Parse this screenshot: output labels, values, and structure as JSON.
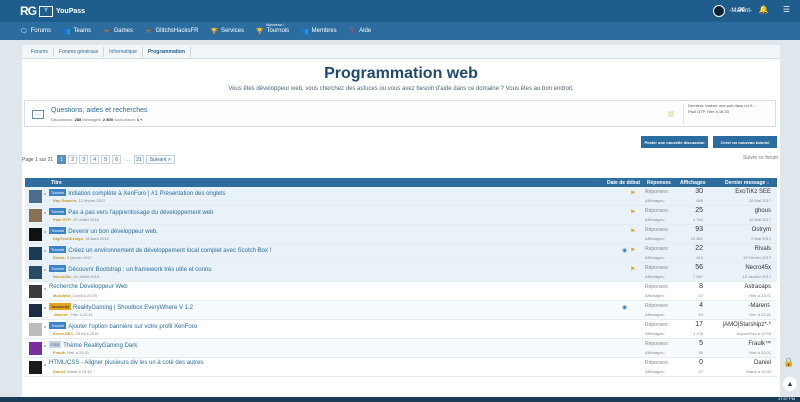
{
  "brand": {
    "logo": "RG",
    "badge": "Y",
    "name": "YouPass"
  },
  "user": {
    "name": "-Marent-"
  },
  "topicons": {
    "mail": "✉",
    "bell": "🔔",
    "menu": "☰"
  },
  "nav": [
    {
      "label": "Forums",
      "icon": "🗨"
    },
    {
      "label": "Teams",
      "icon": "👥"
    },
    {
      "label": "Games",
      "icon": "🎮"
    },
    {
      "label": "GlitchsHacksFR",
      "icon": "🎮"
    },
    {
      "label": "Services",
      "icon": "🏆"
    },
    {
      "label": "Tournois",
      "icon": "🏆",
      "sup": "Nouveau !"
    },
    {
      "label": "Membres",
      "icon": "👥"
    },
    {
      "label": "Aide",
      "icon": "❓"
    }
  ],
  "breadcrumbs": [
    "Forums",
    "Forums généraux",
    "Informatique",
    "Programmation"
  ],
  "page": {
    "title": "Programmation web",
    "description": "Vous êtes développeur web, vous cherchez des astuces ou vous avez besoin d'aide dans ce domaine ? Vous êtes au bon endroit."
  },
  "subforum": {
    "name": "Questions, aides et recherches",
    "disc_label": "Discussions:",
    "disc_value": "285",
    "msg_label": "Messages:",
    "msg_value": "2 805",
    "sub_label": "Sous-forum:",
    "sub_value": "1",
    "last_line1": "Derniers: Insérer une pub dans un X...",
    "last_line2": "Paul GTP, Hier à 18:33"
  },
  "buttons": {
    "mark_read": "Poster une nouvelle discussion",
    "new_thread": "Créer un nouveau tutoriel"
  },
  "pagination": {
    "label": "Page 1 sur 21",
    "pages": [
      "1",
      "2",
      "3",
      "4",
      "5",
      "6"
    ],
    "last": "21",
    "next": "Suivant >"
  },
  "sort_label": "Suivre ce forum",
  "table_headers": {
    "title": "Titre",
    "start_date": "Date de début",
    "replies": "Réponses",
    "views": "Affichages",
    "last_msg": "Dernier message ↓"
  },
  "labels": {
    "replies": "Réponses:",
    "views": "Affichages:"
  },
  "rows": [
    {
      "prefix": "Tutoriel",
      "ptype": "tut",
      "title": "Initiation complète à XenForo | #1 Présentation des onglets",
      "author": "Ray Gamers",
      "date": "12 février 2017",
      "replies": "30",
      "views": "685",
      "last_user": "ExoTiKz SEE",
      "last_date": "28 Mai 2017",
      "av": "#4a6d8c",
      "flag": true,
      "hl": true
    },
    {
      "prefix": "Tutoriel",
      "ptype": "tut",
      "title": "Pas à pas vers l'apprentissage du développement web",
      "author": "Paul GTP",
      "date": "20 Juillet 2016",
      "replies": "25",
      "views": "1 741",
      "last_user": "ghous",
      "last_date": "12 Mai 2017",
      "av": "#8a7055",
      "flag": true,
      "hl": true
    },
    {
      "prefix": "Tutoriel",
      "ptype": "tut",
      "title": "Devenir un bon développeur web.",
      "author": "DigiTechDesign",
      "date": "18 Août 2016",
      "replies": "93",
      "views": "10 882",
      "last_user": "Ostrym",
      "last_date": "2 Mai 2017",
      "av": "#111111",
      "flag": true,
      "hl": true
    },
    {
      "prefix": "Tutoriel",
      "ptype": "tut",
      "title": "Créez un environnement de développement local complet avec Scotch Box !",
      "author": "Rivals",
      "date": "9 janvier 2017",
      "replies": "22",
      "views": "612",
      "last_user": "Rivals",
      "last_date": "19 Février 2017",
      "av": "#1d3a55",
      "flag": true,
      "eye": true,
      "hl": true
    },
    {
      "prefix": "Tutoriel",
      "ptype": "tut",
      "title": "Découvrir Bootstrap : un framework très utile et connu",
      "author": "Necro45x",
      "date": "14 Juillet 2016",
      "replies": "56",
      "views": "7 697",
      "last_user": "Necro45x",
      "last_date": "15 Janvier 2017",
      "av": "#2a4a66",
      "flag": true,
      "hl": true
    },
    {
      "prefix": "",
      "ptype": "",
      "title": "Recherche Développeur Web",
      "author": "McAdelia",
      "date": "Lundi à 22:09",
      "replies": "8",
      "views": "47",
      "last_user": "Astracaps",
      "last_date": "Hier à 22:41",
      "av": "#3c3c3c",
      "alt": true
    },
    {
      "prefix": "Javascript",
      "ptype": "js",
      "title": "RealityGaming | Shoutbox EveryWhere V 1.2",
      "author": "-Marent-",
      "date": "Hier à 22:41",
      "replies": "4",
      "views": "54",
      "last_user": "-Marent-",
      "last_date": "Hier à 22:41",
      "av": "#1b2d45",
      "eye": true
    },
    {
      "prefix": "Tutoriel",
      "ptype": "tut",
      "title": "Ajouter l'option bannière sur votre profil XenForo",
      "author": "Kevin SEC",
      "date": "29 Avril 2015",
      "replies": "17",
      "views": "1 278",
      "last_user": "|AMO|Starshipz*-*",
      "last_date": "Aujourd'hui à 12:33",
      "av": "#bcbcbc",
      "alt": true
    },
    {
      "prefix": "CSS",
      "ptype": "css",
      "title": "Thème RealityGaming Dark",
      "author": "Fraulk",
      "date": "Hier à 20:31",
      "replies": "5",
      "views": "56",
      "last_user": "Fraulk™",
      "last_date": "Hier à 22:01",
      "av": "#7a2f9c"
    },
    {
      "prefix": "",
      "ptype": "",
      "title": "HTML/CSS - Aligner plusieurs div les un à coté des autres",
      "author": "Daniel",
      "date": "Mardi à 19:40",
      "replies": "0",
      "views": "27",
      "last_user": "Daniel",
      "last_date": "Mardi à 19:40",
      "av": "#1a1a1a",
      "alt": true
    }
  ],
  "clock": "17:37 PM"
}
